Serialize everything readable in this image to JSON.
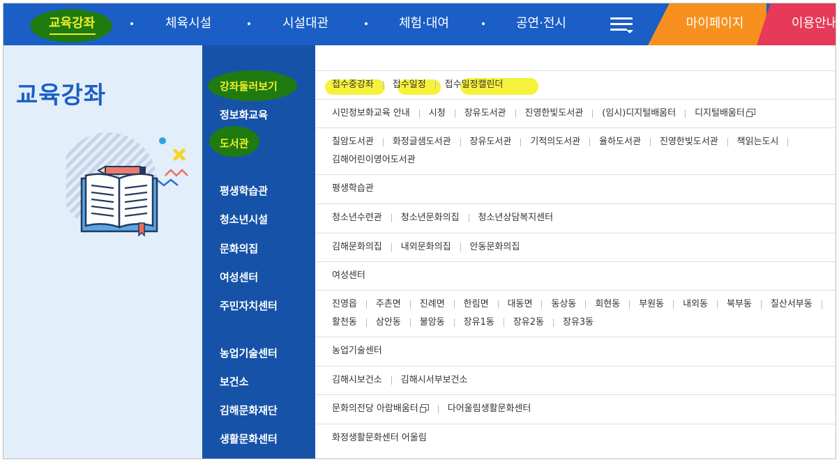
{
  "nav": {
    "items": [
      "교육강좌",
      "체육시설",
      "시설대관",
      "체험·대여",
      "공연·전시"
    ],
    "mypage": "마이페이지",
    "guide": "이용안내"
  },
  "left": {
    "title": "교육강좌"
  },
  "categories": [
    "강좌둘러보기",
    "정보화교육",
    "도서관",
    "평생학습관",
    "청소년시설",
    "문화의집",
    "여성센터",
    "주민자치센터",
    "농업기술센터",
    "보건소",
    "김해문화재단",
    "생활문화센터"
  ],
  "rows": [
    {
      "links": [
        {
          "t": "접수중강좌"
        },
        {
          "t": "접수일정"
        },
        {
          "t": "접수일정캘린더"
        }
      ]
    },
    {
      "links": [
        {
          "t": "시민정보화교육 안내"
        },
        {
          "t": "시청"
        },
        {
          "t": "장유도서관"
        },
        {
          "t": "진영한빛도서관"
        },
        {
          "t": "(임시)디지털배움터"
        },
        {
          "t": "디지털배움터",
          "ext": true
        }
      ]
    },
    {
      "links": [
        {
          "t": "칠암도서관"
        },
        {
          "t": "화정글샘도서관"
        },
        {
          "t": "장유도서관"
        },
        {
          "t": "기적의도서관"
        },
        {
          "t": "율하도서관"
        },
        {
          "t": "진영한빛도서관"
        },
        {
          "t": "책읽는도시"
        },
        {
          "t": "김해어린이영어도서관"
        }
      ]
    },
    {
      "links": [
        {
          "t": "평생학습관"
        }
      ]
    },
    {
      "links": [
        {
          "t": "청소년수련관"
        },
        {
          "t": "청소년문화의집"
        },
        {
          "t": "청소년상담복지센터"
        }
      ]
    },
    {
      "links": [
        {
          "t": "김해문화의집"
        },
        {
          "t": "내외문화의집"
        },
        {
          "t": "안동문화의집"
        }
      ]
    },
    {
      "links": [
        {
          "t": "여성센터"
        }
      ]
    },
    {
      "links": [
        {
          "t": "진영읍"
        },
        {
          "t": "주촌면"
        },
        {
          "t": "진례면"
        },
        {
          "t": "한림면"
        },
        {
          "t": "대동면"
        },
        {
          "t": "동상동"
        },
        {
          "t": "회현동"
        },
        {
          "t": "부원동"
        },
        {
          "t": "내외동"
        },
        {
          "t": "북부동"
        },
        {
          "t": "칠산서부동"
        },
        {
          "t": "활천동"
        },
        {
          "t": "삼안동"
        },
        {
          "t": "불암동"
        },
        {
          "t": "장유1동"
        },
        {
          "t": "장유2동"
        },
        {
          "t": "장유3동"
        }
      ]
    },
    {
      "links": [
        {
          "t": "농업기술센터"
        }
      ]
    },
    {
      "links": [
        {
          "t": "김해시보건소"
        },
        {
          "t": "김해시서부보건소"
        }
      ]
    },
    {
      "links": [
        {
          "t": "문화의전당 아람배움터",
          "ext": true
        },
        {
          "t": "다어울림생활문화센터"
        }
      ]
    },
    {
      "links": [
        {
          "t": "화정생활문화센터 어울림"
        }
      ]
    }
  ],
  "colors": {
    "nav_bg": "#1a5ec6",
    "cat_bg": "#1653a8",
    "left_bg": "#e2eefa",
    "mypage_bg": "#f7901e",
    "guide_bg": "#e63a58",
    "active_text": "#f1ee2e"
  },
  "icons": [
    "menu-icon",
    "open-book-icon",
    "pencil-icon",
    "external-link-icon"
  ]
}
